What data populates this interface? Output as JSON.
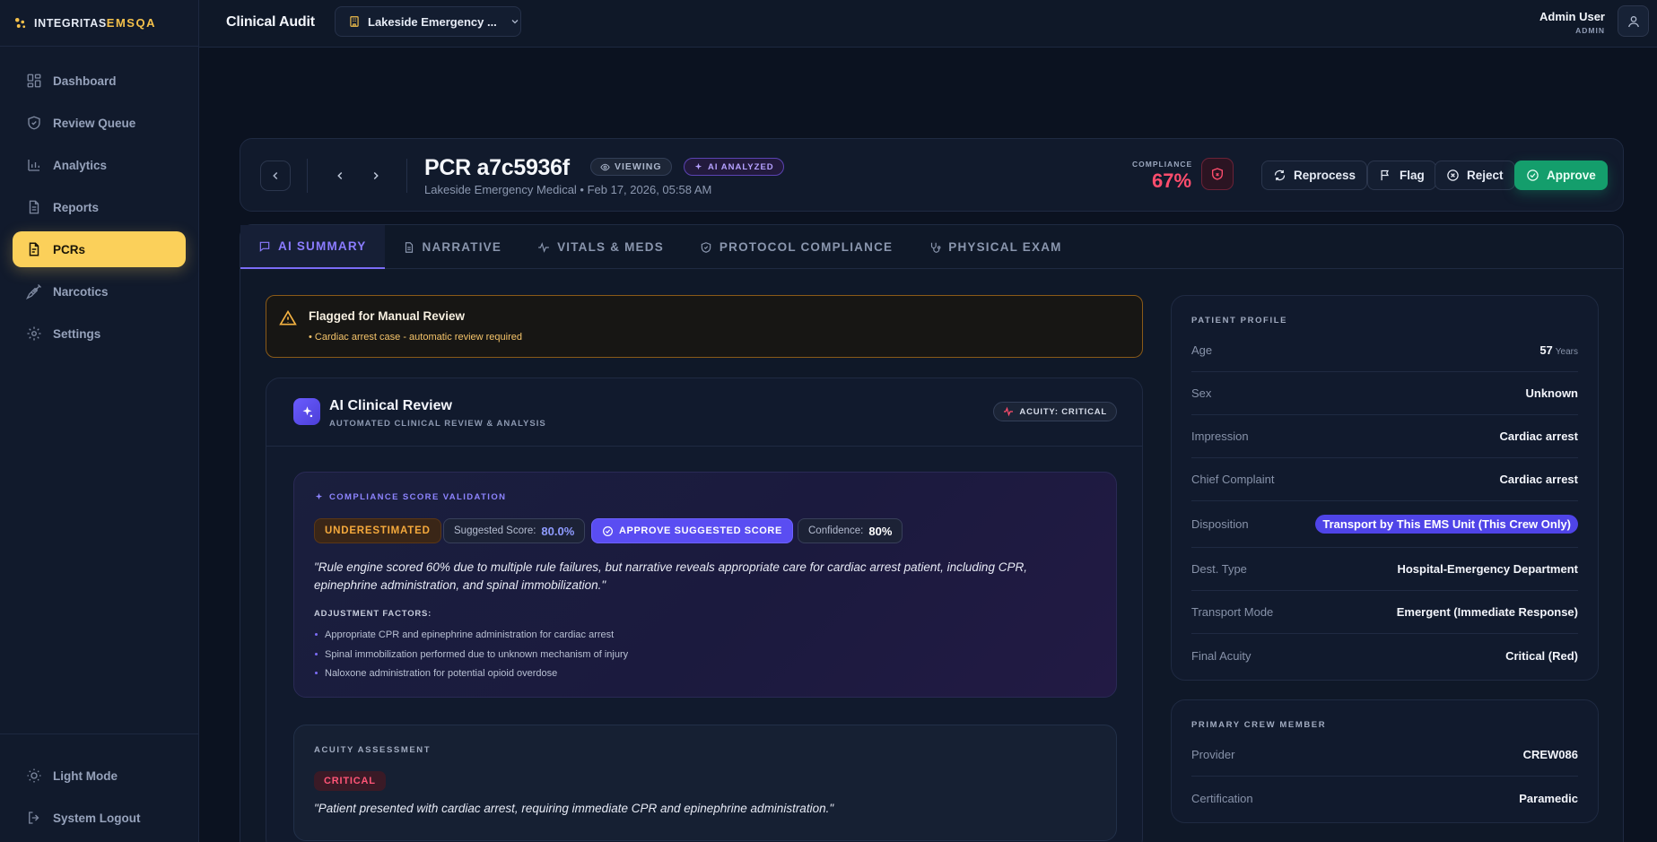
{
  "brand": {
    "name": "INTEGRITAS",
    "accent": "EMSQA"
  },
  "sidebar": {
    "items": [
      {
        "label": "Dashboard",
        "icon": "dashboard-icon"
      },
      {
        "label": "Review Queue",
        "icon": "shield-check-icon"
      },
      {
        "label": "Analytics",
        "icon": "bar-chart-icon"
      },
      {
        "label": "Reports",
        "icon": "document-icon"
      },
      {
        "label": "PCRs",
        "icon": "file-icon",
        "active": true
      },
      {
        "label": "Narcotics",
        "icon": "syringe-icon"
      },
      {
        "label": "Settings",
        "icon": "gear-icon"
      }
    ],
    "bottom": [
      {
        "label": "Light Mode",
        "icon": "sun-icon"
      },
      {
        "label": "System Logout",
        "icon": "logout-icon"
      }
    ]
  },
  "topbar": {
    "title": "Clinical Audit",
    "org_select": "Lakeside Emergency ...",
    "user_name": "Admin User",
    "user_role": "ADMIN"
  },
  "header": {
    "pcr_title": "PCR a7c5936f",
    "viewing_label": "VIEWING",
    "ai_label": "AI ANALYZED",
    "subtitle": "Lakeside Emergency Medical • Feb 17, 2026, 05:58 AM",
    "compliance_label": "COMPLIANCE",
    "compliance_value": "67%",
    "buttons": {
      "reprocess": "Reprocess",
      "flag": "Flag",
      "reject": "Reject",
      "approve": "Approve"
    }
  },
  "tabs": [
    {
      "label": "AI SUMMARY",
      "icon": "chat-icon",
      "active": true
    },
    {
      "label": "NARRATIVE",
      "icon": "document-icon"
    },
    {
      "label": "VITALS & MEDS",
      "icon": "pulse-icon"
    },
    {
      "label": "PROTOCOL COMPLIANCE",
      "icon": "shield-check-icon"
    },
    {
      "label": "PHYSICAL EXAM",
      "icon": "stethoscope-icon"
    }
  ],
  "flagged": {
    "title": "Flagged for Manual Review",
    "item": "• Cardiac arrest case - automatic review required"
  },
  "ai_review": {
    "title": "AI Clinical Review",
    "subtitle": "AUTOMATED CLINICAL REVIEW & ANALYSIS",
    "acuity_pill": "ACUITY: CRITICAL",
    "csv": {
      "label": "COMPLIANCE SCORE VALIDATION",
      "status": "UNDERESTIMATED",
      "suggested_label": "Suggested Score:",
      "suggested_value": "80.0%",
      "approve_label": "APPROVE SUGGESTED SCORE",
      "confidence_label": "Confidence:",
      "confidence_value": "80%",
      "quote": "\"Rule engine scored 60% due to multiple rule failures, but narrative reveals appropriate care for cardiac arrest patient, including CPR, epinephrine administration, and spinal immobilization.\"",
      "adjust_label": "ADJUSTMENT FACTORS:",
      "factors": [
        "Appropriate CPR and epinephrine administration for cardiac arrest",
        "Spinal immobilization performed due to unknown mechanism of injury",
        "Naloxone administration for potential opioid overdose"
      ]
    },
    "acuity": {
      "label": "ACUITY ASSESSMENT",
      "level": "CRITICAL",
      "quote": "\"Patient presented with cardiac arrest, requiring immediate CPR and epinephrine administration.\""
    }
  },
  "patient_profile": {
    "label": "PATIENT PROFILE",
    "rows": [
      {
        "key": "Age",
        "value": "57",
        "unit": "Years"
      },
      {
        "key": "Sex",
        "value": "Unknown"
      },
      {
        "key": "Impression",
        "value": "Cardiac arrest"
      },
      {
        "key": "Chief Complaint",
        "value": "Cardiac arrest"
      },
      {
        "key": "Disposition",
        "value": "Transport by This EMS Unit (This Crew Only)"
      },
      {
        "key": "Dest. Type",
        "value": "Hospital-Emergency Department"
      },
      {
        "key": "Transport Mode",
        "value": "Emergent (Immediate Response)"
      },
      {
        "key": "Final Acuity",
        "value": "Critical (Red)"
      }
    ]
  },
  "crew": {
    "label": "PRIMARY CREW MEMBER",
    "rows": [
      {
        "key": "Provider",
        "value": "CREW086"
      },
      {
        "key": "Certification",
        "value": "Paramedic"
      }
    ]
  },
  "colors": {
    "accent": "#7b6cf6",
    "active_nav": "#fbd05a",
    "approve": "#149e6c",
    "danger": "#ff4d6d",
    "warning": "#f5a93c"
  }
}
